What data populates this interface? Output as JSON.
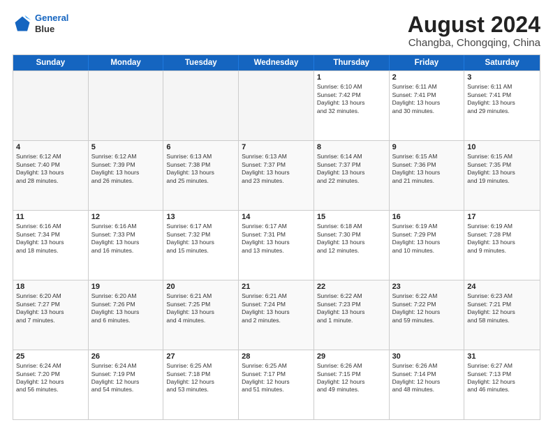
{
  "header": {
    "logo_line1": "General",
    "logo_line2": "Blue",
    "main_title": "August 2024",
    "subtitle": "Changba, Chongqing, China"
  },
  "calendar": {
    "days_of_week": [
      "Sunday",
      "Monday",
      "Tuesday",
      "Wednesday",
      "Thursday",
      "Friday",
      "Saturday"
    ],
    "rows": [
      [
        {
          "day": "",
          "info": "",
          "empty": true
        },
        {
          "day": "",
          "info": "",
          "empty": true
        },
        {
          "day": "",
          "info": "",
          "empty": true
        },
        {
          "day": "",
          "info": "",
          "empty": true
        },
        {
          "day": "1",
          "info": "Sunrise: 6:10 AM\nSunset: 7:42 PM\nDaylight: 13 hours\nand 32 minutes."
        },
        {
          "day": "2",
          "info": "Sunrise: 6:11 AM\nSunset: 7:41 PM\nDaylight: 13 hours\nand 30 minutes."
        },
        {
          "day": "3",
          "info": "Sunrise: 6:11 AM\nSunset: 7:41 PM\nDaylight: 13 hours\nand 29 minutes."
        }
      ],
      [
        {
          "day": "4",
          "info": "Sunrise: 6:12 AM\nSunset: 7:40 PM\nDaylight: 13 hours\nand 28 minutes."
        },
        {
          "day": "5",
          "info": "Sunrise: 6:12 AM\nSunset: 7:39 PM\nDaylight: 13 hours\nand 26 minutes."
        },
        {
          "day": "6",
          "info": "Sunrise: 6:13 AM\nSunset: 7:38 PM\nDaylight: 13 hours\nand 25 minutes."
        },
        {
          "day": "7",
          "info": "Sunrise: 6:13 AM\nSunset: 7:37 PM\nDaylight: 13 hours\nand 23 minutes."
        },
        {
          "day": "8",
          "info": "Sunrise: 6:14 AM\nSunset: 7:37 PM\nDaylight: 13 hours\nand 22 minutes."
        },
        {
          "day": "9",
          "info": "Sunrise: 6:15 AM\nSunset: 7:36 PM\nDaylight: 13 hours\nand 21 minutes."
        },
        {
          "day": "10",
          "info": "Sunrise: 6:15 AM\nSunset: 7:35 PM\nDaylight: 13 hours\nand 19 minutes."
        }
      ],
      [
        {
          "day": "11",
          "info": "Sunrise: 6:16 AM\nSunset: 7:34 PM\nDaylight: 13 hours\nand 18 minutes."
        },
        {
          "day": "12",
          "info": "Sunrise: 6:16 AM\nSunset: 7:33 PM\nDaylight: 13 hours\nand 16 minutes."
        },
        {
          "day": "13",
          "info": "Sunrise: 6:17 AM\nSunset: 7:32 PM\nDaylight: 13 hours\nand 15 minutes."
        },
        {
          "day": "14",
          "info": "Sunrise: 6:17 AM\nSunset: 7:31 PM\nDaylight: 13 hours\nand 13 minutes."
        },
        {
          "day": "15",
          "info": "Sunrise: 6:18 AM\nSunset: 7:30 PM\nDaylight: 13 hours\nand 12 minutes."
        },
        {
          "day": "16",
          "info": "Sunrise: 6:19 AM\nSunset: 7:29 PM\nDaylight: 13 hours\nand 10 minutes."
        },
        {
          "day": "17",
          "info": "Sunrise: 6:19 AM\nSunset: 7:28 PM\nDaylight: 13 hours\nand 9 minutes."
        }
      ],
      [
        {
          "day": "18",
          "info": "Sunrise: 6:20 AM\nSunset: 7:27 PM\nDaylight: 13 hours\nand 7 minutes."
        },
        {
          "day": "19",
          "info": "Sunrise: 6:20 AM\nSunset: 7:26 PM\nDaylight: 13 hours\nand 6 minutes."
        },
        {
          "day": "20",
          "info": "Sunrise: 6:21 AM\nSunset: 7:25 PM\nDaylight: 13 hours\nand 4 minutes."
        },
        {
          "day": "21",
          "info": "Sunrise: 6:21 AM\nSunset: 7:24 PM\nDaylight: 13 hours\nand 2 minutes."
        },
        {
          "day": "22",
          "info": "Sunrise: 6:22 AM\nSunset: 7:23 PM\nDaylight: 13 hours\nand 1 minute."
        },
        {
          "day": "23",
          "info": "Sunrise: 6:22 AM\nSunset: 7:22 PM\nDaylight: 12 hours\nand 59 minutes."
        },
        {
          "day": "24",
          "info": "Sunrise: 6:23 AM\nSunset: 7:21 PM\nDaylight: 12 hours\nand 58 minutes."
        }
      ],
      [
        {
          "day": "25",
          "info": "Sunrise: 6:24 AM\nSunset: 7:20 PM\nDaylight: 12 hours\nand 56 minutes."
        },
        {
          "day": "26",
          "info": "Sunrise: 6:24 AM\nSunset: 7:19 PM\nDaylight: 12 hours\nand 54 minutes."
        },
        {
          "day": "27",
          "info": "Sunrise: 6:25 AM\nSunset: 7:18 PM\nDaylight: 12 hours\nand 53 minutes."
        },
        {
          "day": "28",
          "info": "Sunrise: 6:25 AM\nSunset: 7:17 PM\nDaylight: 12 hours\nand 51 minutes."
        },
        {
          "day": "29",
          "info": "Sunrise: 6:26 AM\nSunset: 7:15 PM\nDaylight: 12 hours\nand 49 minutes."
        },
        {
          "day": "30",
          "info": "Sunrise: 6:26 AM\nSunset: 7:14 PM\nDaylight: 12 hours\nand 48 minutes."
        },
        {
          "day": "31",
          "info": "Sunrise: 6:27 AM\nSunset: 7:13 PM\nDaylight: 12 hours\nand 46 minutes."
        }
      ]
    ]
  }
}
